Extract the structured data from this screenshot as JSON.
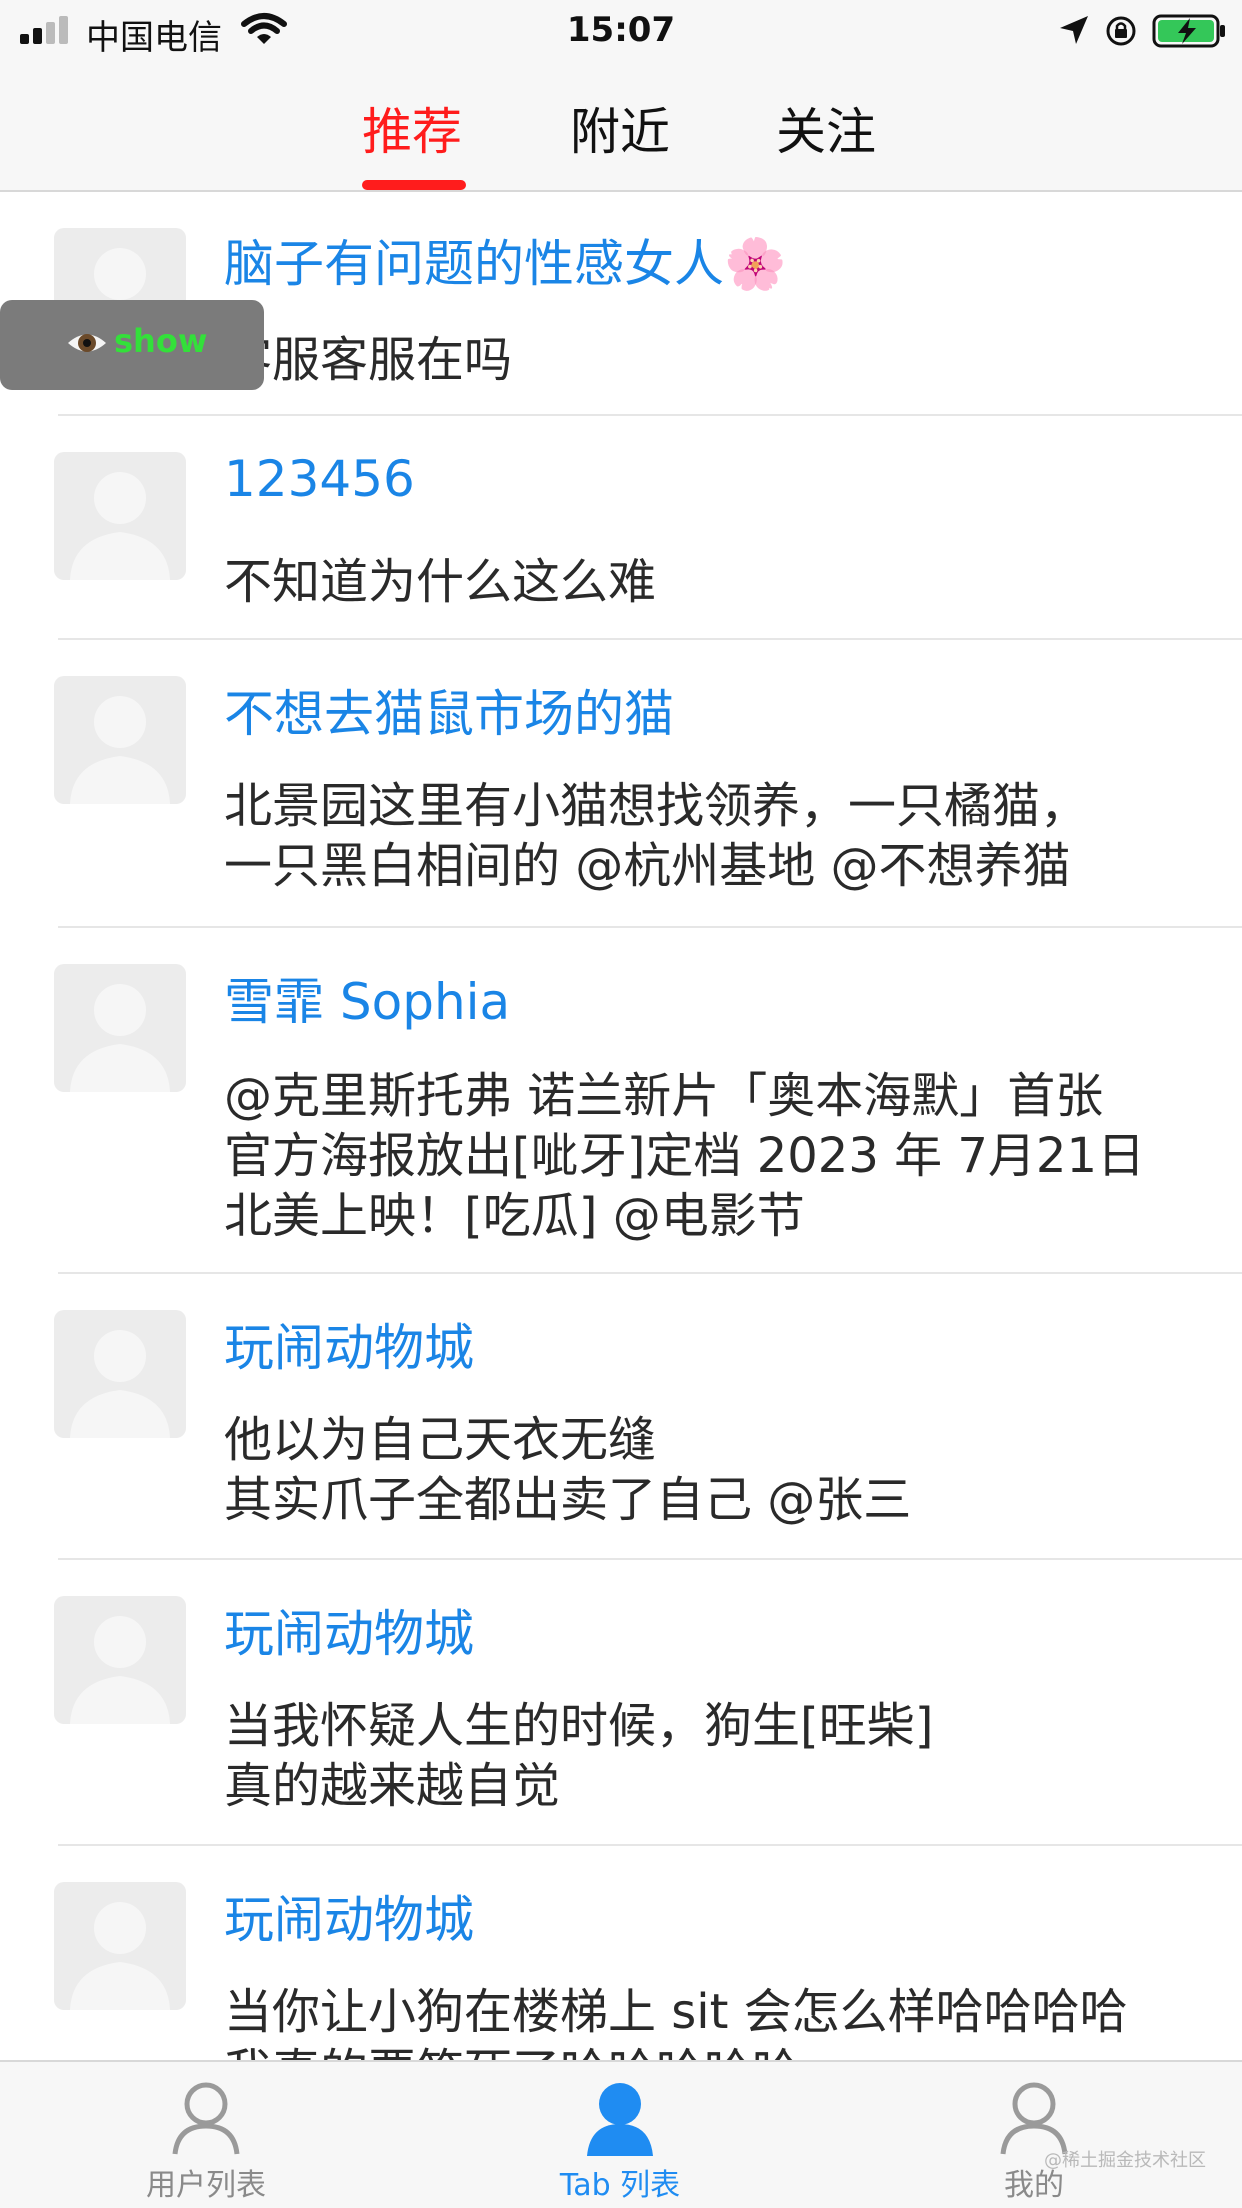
{
  "status_bar": {
    "carrier": "中国电信",
    "time": "15:07",
    "icons": [
      "signal-icon",
      "wifi-icon",
      "location-arrow-icon",
      "orientation-lock-icon",
      "battery-charging-icon"
    ]
  },
  "top_tabs": [
    {
      "label": "推荐",
      "active": true
    },
    {
      "label": "附近",
      "active": false
    },
    {
      "label": "关注",
      "active": false
    }
  ],
  "show_button": {
    "label": "show",
    "icon": "eye-icon"
  },
  "feed": [
    {
      "username": "脑子有问题的性感女人🌸",
      "lines": [
        "客服客服在吗"
      ]
    },
    {
      "username": "123456",
      "lines": [
        "不知道为什么这么难"
      ]
    },
    {
      "username": "不想去猫鼠市场的猫",
      "lines": [
        "北景园这里有小猫想找领养，一只橘猫，",
        "一只黑白相间的 @杭州基地 @不想养猫"
      ]
    },
    {
      "username": "雪霏 Sophia",
      "lines": [
        "@克里斯托弗 诺兰新片「奥本海默」首张",
        "官方海报放出[呲牙]定档 2023 年 7月21日",
        "北美上映！[吃瓜] @电影节"
      ]
    },
    {
      "username": "玩闹动物城",
      "lines": [
        "他以为自己天衣无缝",
        "其实爪子全都出卖了自己 @张三"
      ]
    },
    {
      "username": "玩闹动物城",
      "lines": [
        "当我怀疑人生的时候，狗生[旺柴]",
        "真的越来越自觉"
      ]
    },
    {
      "username": "玩闹动物城",
      "lines": [
        "当你让小狗在楼梯上 sit 会怎么样哈哈哈哈",
        "我真的要笑死了哈哈哈哈哈"
      ]
    }
  ],
  "bottom_tabs": [
    {
      "label": "用户列表",
      "icon": "user-icon",
      "active": false
    },
    {
      "label": "Tab 列表",
      "icon": "user-icon",
      "active": true
    },
    {
      "label": "我的",
      "icon": "user-icon",
      "active": false
    }
  ],
  "watermark": "@稀土掘金技术社区",
  "colors": {
    "accent_red": "#ff1c1c",
    "link_blue": "#1a85e6",
    "tab_active_blue": "#1f8cf2",
    "show_green": "#33e03a"
  }
}
